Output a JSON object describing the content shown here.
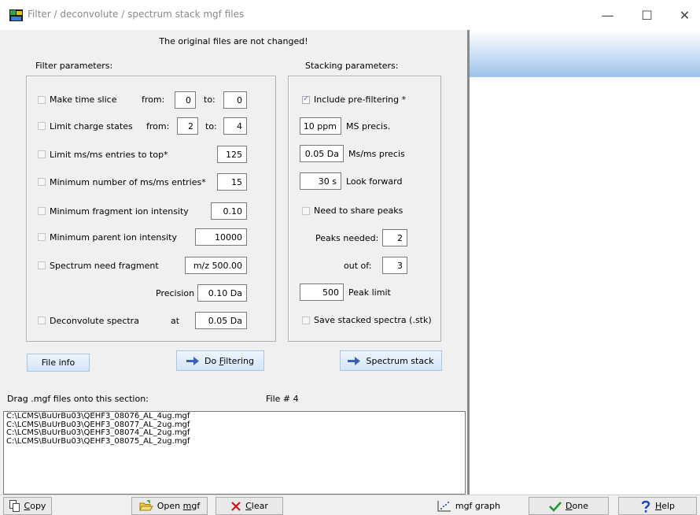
{
  "window": {
    "title": "Filter / deconvolute / spectrum stack mgf files",
    "minimize": "—",
    "maximize": "☐",
    "close": "✕"
  },
  "notice": "The original files are not changed!",
  "filter": {
    "title": "Filter parameters:",
    "time_slice": {
      "label": "Make time slice",
      "from_label": "from:",
      "from": "0",
      "to_label": "to:",
      "to": "0",
      "checked": false
    },
    "charge": {
      "label": "Limit charge states",
      "from_label": "from:",
      "from": "2",
      "to_label": "to:",
      "to": "4",
      "checked": false
    },
    "limit_top": {
      "label": "Limit ms/ms entries to top*",
      "value": "125",
      "checked": false
    },
    "min_entries": {
      "label": "Minimum number of ms/ms entries*",
      "value": "15",
      "checked": false
    },
    "min_fragment": {
      "label": "Minimum fragment ion intensity",
      "value": "0.10",
      "checked": false
    },
    "min_parent": {
      "label": "Minimum parent ion intensity",
      "value": "10000",
      "checked": false
    },
    "need_fragment": {
      "label": "Spectrum need fragment",
      "value": "m/z 500.00",
      "checked": false
    },
    "precision": {
      "label": "Precision",
      "value": "0.10 Da"
    },
    "deconvolute": {
      "label": "Deconvolute spectra",
      "at_label": "at",
      "value": "0.05 Da",
      "checked": false
    }
  },
  "stack": {
    "title": "Stacking parameters:",
    "include_prefilter": {
      "label": "Include pre-filtering *",
      "checked": true
    },
    "ms_precis": {
      "value": "10 ppm",
      "label": "MS precis."
    },
    "msms_precis": {
      "value": "0.05 Da",
      "label": "Ms/ms precis"
    },
    "look_forward": {
      "value": "30 s",
      "label": "Look forward"
    },
    "share_peaks": {
      "label": "Need to share peaks",
      "checked": false
    },
    "peaks_needed": {
      "label": "Peaks needed:",
      "value": "2"
    },
    "out_of": {
      "label": "out of:",
      "value": "3"
    },
    "peak_limit": {
      "value": "500",
      "label": "Peak limit"
    },
    "save_stacked": {
      "label": "Save stacked spectra (.stk)",
      "checked": false
    }
  },
  "buttons": {
    "file_info": "File info",
    "do_filtering_pre": "Do ",
    "do_filtering_u": "F",
    "do_filtering_post": "iltering",
    "spectrum_stack": "Spectrum stack"
  },
  "drop": {
    "label": "Drag .mgf files onto this section:",
    "count": "File # 4",
    "files": [
      "C:\\LCMS\\BuUrBu03\\QEHF3_08076_AL_4ug.mgf",
      "C:\\LCMS\\BuUrBu03\\QEHF3_08077_AL_2ug.mgf",
      "C:\\LCMS\\BuUrBu03\\QEHF3_08074_AL_2ug.mgf",
      "C:\\LCMS\\BuUrBu03\\QEHF3_08075_AL_2ug.mgf"
    ]
  },
  "toolbar": {
    "copy_u": "C",
    "copy_rest": "opy",
    "open_pre": "Open ",
    "open_u": "m",
    "open_rest": "gf",
    "clear_u": "C",
    "clear_rest": "lear",
    "graph": "mgf graph",
    "done_u": "D",
    "done_rest": "one",
    "help_u": "H",
    "help_rest": "elp"
  },
  "colors": {
    "arrow": "#3b5fc0",
    "clear_x": "#d21414",
    "check_green": "#1f9a2b",
    "help_blue": "#1846b8",
    "header_gradient": "#9ec2ec"
  },
  "icons": [
    "app-icon",
    "copy-icon",
    "open-folder-icon",
    "clear-x-icon",
    "graph-icon",
    "done-check-icon",
    "help-icon",
    "right-arrow-icon"
  ]
}
